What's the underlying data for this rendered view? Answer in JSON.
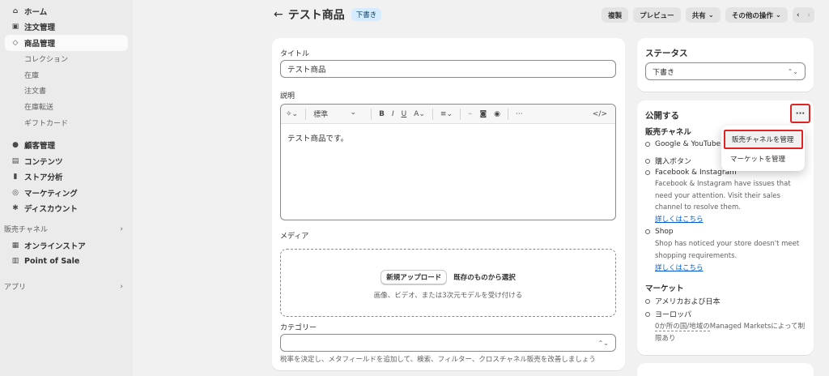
{
  "sidebar": {
    "items": [
      {
        "icon": "home-icon",
        "glyph": "⌂",
        "label": "ホーム"
      },
      {
        "icon": "inbox-icon",
        "glyph": "▣",
        "label": "注文管理"
      },
      {
        "icon": "tag-icon",
        "glyph": "◇",
        "label": "商品管理"
      }
    ],
    "product_subs": [
      "コレクション",
      "在庫",
      "注文書",
      "在庫転送",
      "ギフトカード"
    ],
    "items2": [
      {
        "icon": "person-icon",
        "glyph": "●",
        "label": "顧客管理"
      },
      {
        "icon": "content-icon",
        "glyph": "▤",
        "label": "コンテンツ"
      },
      {
        "icon": "analytics-icon",
        "glyph": "▮",
        "label": "ストア分析"
      },
      {
        "icon": "target-icon",
        "glyph": "◎",
        "label": "マーケティング"
      },
      {
        "icon": "discount-icon",
        "glyph": "✱",
        "label": "ディスカウント"
      }
    ],
    "sales_channels_label": "販売チャネル",
    "channels": [
      {
        "icon": "store-icon",
        "glyph": "▦",
        "label": "オンラインストア"
      },
      {
        "icon": "pos-icon",
        "glyph": "▥",
        "label": "Point of Sale"
      }
    ],
    "apps_label": "アプリ"
  },
  "header": {
    "title": "テスト商品",
    "badge": "下書き",
    "actions": {
      "duplicate": "複製",
      "preview": "プレビュー",
      "share": "共有",
      "more_actions": "その他の操作"
    }
  },
  "main": {
    "title_label": "タイトル",
    "title_value": "テスト商品",
    "description_label": "説明",
    "format_select": "標準",
    "description_value": "テスト商品です。",
    "media_label": "メディア",
    "upload_new": "新規アップロード",
    "select_existing": "既存のものから選択",
    "media_hint": "画像、ビデオ、または3次元モデルを受け付ける",
    "category_label": "カテゴリー",
    "category_help": "税率を決定し、メタフィールドを追加して、検索、フィルター、クロスチャネル販売を改善しましょう"
  },
  "status": {
    "title": "ステータス",
    "value": "下書き"
  },
  "publishing": {
    "title": "公開する",
    "more": "···",
    "sales_channels_heading": "販売チャネル",
    "channels": {
      "google": "Google & YouTube",
      "buy_button": "購入ボタン",
      "facebook": "Facebook & Instagram",
      "facebook_desc": "Facebook & Instagram have issues that need your attention. Visit their sales channel to resolve them.",
      "facebook_link": "詳しくはこちら",
      "shop": "Shop",
      "shop_desc": "Shop has noticed your store doesn't meet shopping requirements.",
      "shop_link": "詳しくはこちら"
    },
    "markets_heading": "マーケット",
    "markets": {
      "usa_japan": "アメリカおよび日本",
      "europe": "ヨーロッパ",
      "europe_desc": "0か所の国/地域のManaged Marketsによって制限あり",
      "europe_desc_part1": "0か所の国/地域の",
      "europe_desc_part2": "Managed Marketsによって制限あり"
    },
    "popover": {
      "manage_channels": "販売チャネルを管理",
      "manage_markets": "マーケットを管理"
    }
  }
}
